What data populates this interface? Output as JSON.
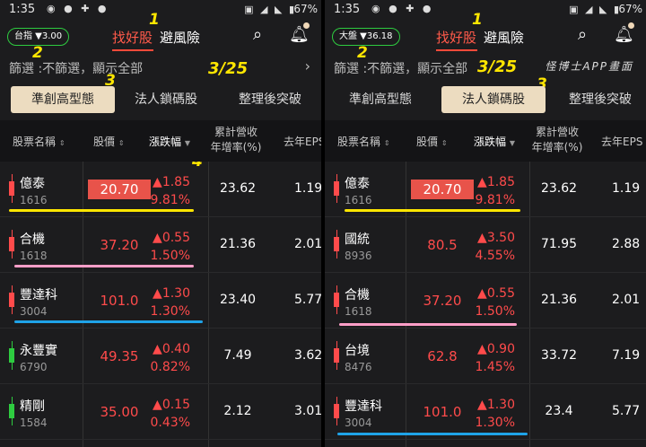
{
  "app": {
    "status_time": "1:35",
    "battery": "67%"
  },
  "header": {
    "tab_picks": "找好股",
    "tab_avoid": "避風險",
    "search_icon": "search-icon",
    "bell_icon": "bell-icon"
  },
  "annotations": {
    "n1": "1",
    "n2": "2",
    "n3": "3",
    "n4": "4",
    "date": "3/25",
    "watermark": "怪博士APP畫面"
  },
  "colors": {
    "up": "#ff4b4b",
    "down_candle": "#2ecc40",
    "yellow_line": "#ffe600",
    "pink_line": "#ff9ec8",
    "blue_line": "#1fa3e8",
    "active_tab": "#ecdcc0"
  },
  "left": {
    "index_label": "台指 ▼3.00",
    "filter_text": "篩選 :不篩選，顯示全部",
    "subtabs": [
      "準創高型態",
      "法人鎖碼股",
      "整理後突破"
    ],
    "active_subtab": 0,
    "columns": [
      "股票名稱",
      "股價",
      "漲跌幅",
      "累計營收",
      "年增率(%)",
      "去年EPS"
    ],
    "rows": [
      {
        "name": "億泰",
        "code": "1616",
        "price": "20.70",
        "chg": "▲1.85",
        "pct": "9.81%",
        "rev": "23.62",
        "eps": "1.19"
      },
      {
        "name": "合機",
        "code": "1618",
        "price": "37.20",
        "chg": "▲0.55",
        "pct": "1.50%",
        "rev": "21.36",
        "eps": "2.01"
      },
      {
        "name": "豐達科",
        "code": "3004",
        "price": "101.0",
        "chg": "▲1.30",
        "pct": "1.30%",
        "rev": "23.40",
        "eps": "5.77"
      },
      {
        "name": "永豐實",
        "code": "6790",
        "price": "49.35",
        "chg": "▲0.40",
        "pct": "0.82%",
        "rev": "7.49",
        "eps": "3.62"
      },
      {
        "name": "精剛",
        "code": "1584",
        "price": "35.00",
        "chg": "▲0.15",
        "pct": "0.43%",
        "rev": "2.12",
        "eps": "3.01"
      }
    ]
  },
  "right": {
    "index_label": "大盤 ▼36.18",
    "filter_text": "篩選 :不篩選，顯示全部",
    "subtabs": [
      "準創高型態",
      "法人鎖碼股",
      "整理後突破"
    ],
    "active_subtab": 1,
    "columns": [
      "股票名稱",
      "股價",
      "漲跌幅",
      "累計營收",
      "年增率(%)",
      "去年EPS"
    ],
    "rows": [
      {
        "name": "億泰",
        "code": "1616",
        "price": "20.70",
        "chg": "▲1.85",
        "pct": "9.81%",
        "rev": "23.62",
        "eps": "1.19"
      },
      {
        "name": "國統",
        "code": "8936",
        "price": "80.5",
        "chg": "▲3.50",
        "pct": "4.55%",
        "rev": "71.95",
        "eps": "2.88"
      },
      {
        "name": "合機",
        "code": "1618",
        "price": "37.20",
        "chg": "▲0.55",
        "pct": "1.50%",
        "rev": "21.36",
        "eps": "2.01"
      },
      {
        "name": "台境",
        "code": "8476",
        "price": "62.8",
        "chg": "▲0.90",
        "pct": "1.45%",
        "rev": "33.72",
        "eps": "7.19"
      },
      {
        "name": "豐達科",
        "code": "3004",
        "price": "101.0",
        "chg": "▲1.30",
        "pct": "1.30%",
        "rev": "23.4",
        "eps": "5.77"
      }
    ]
  }
}
